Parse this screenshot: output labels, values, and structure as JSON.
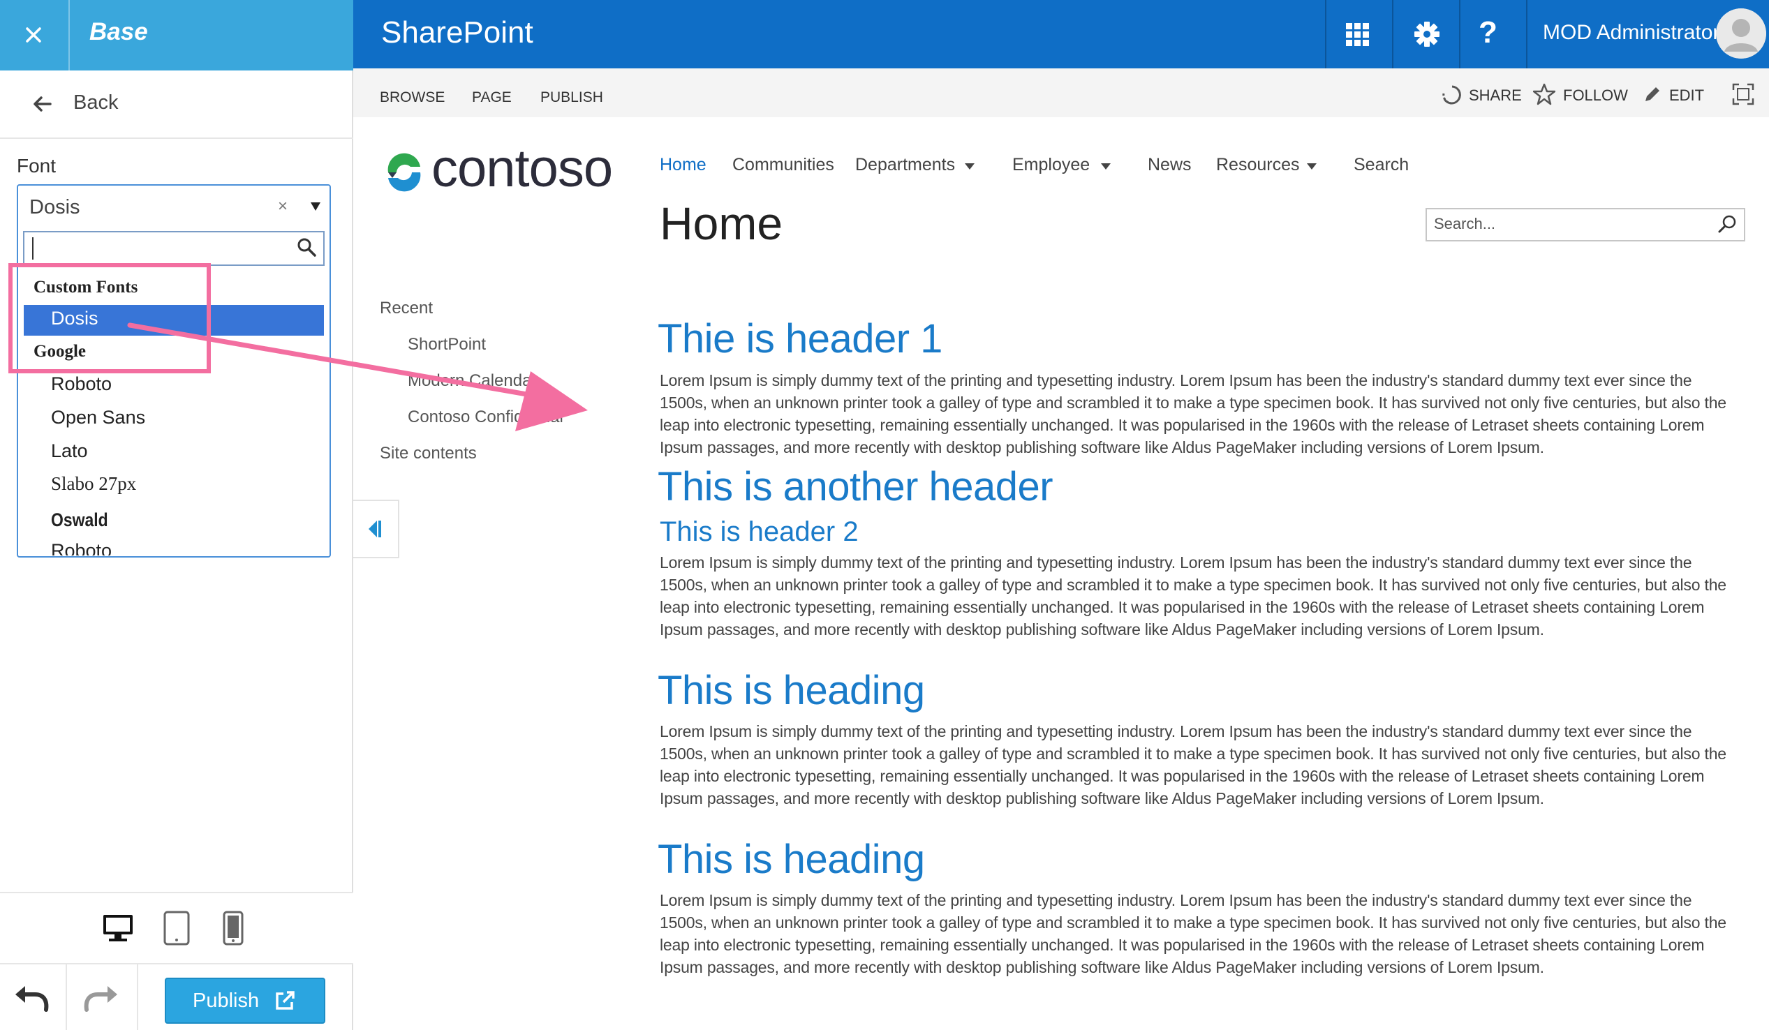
{
  "panel": {
    "title": "Base",
    "back_label": "Back",
    "font_label": "Font",
    "select": {
      "value": "Dosis",
      "clear": "×",
      "search_value": "",
      "groups": [
        {
          "label": "Custom Fonts",
          "options": [
            "Dosis"
          ]
        },
        {
          "label": "Google",
          "options": [
            "Roboto",
            "Open Sans",
            "Lato",
            "Slabo 27px",
            "Oswald",
            "Roboto Condensed"
          ]
        }
      ],
      "selected": "Dosis"
    },
    "publish_label": "Publish",
    "icons": [
      "close-icon",
      "back-arrow-icon",
      "search-icon",
      "desktop-icon",
      "tablet-icon",
      "mobile-icon",
      "undo-icon",
      "redo-icon",
      "external-link-icon"
    ]
  },
  "suitebar": {
    "brand": "SharePoint",
    "help": "?",
    "user_name": "MOD Administrator",
    "icons": [
      "app-launcher-icon",
      "gear-icon",
      "help-icon",
      "avatar"
    ]
  },
  "ribbon": {
    "tabs": [
      "BROWSE",
      "PAGE",
      "PUBLISH"
    ],
    "actions": [
      {
        "label": "SHARE",
        "icon": "share-icon"
      },
      {
        "label": "FOLLOW",
        "icon": "star-icon"
      },
      {
        "label": "EDIT",
        "icon": "pencil-icon"
      }
    ]
  },
  "site": {
    "logo_text": "contoso",
    "nav": [
      "Home",
      "Communities",
      "Departments",
      "Employee",
      "News",
      "Resources",
      "Search"
    ],
    "page_title": "Home",
    "search_placeholder": "Search..."
  },
  "quick_launch": {
    "recent": "Recent",
    "items": [
      "ShortPoint",
      "Modern Calendar",
      "Contoso Confidential"
    ],
    "site_contents": "Site contents"
  },
  "content": {
    "header1": "Thie is header 1",
    "another_header": "This is another header",
    "header2": "This is header 2",
    "heading": "This is heading",
    "lorem": "Lorem Ipsum is simply dummy text of the printing and typesetting industry. Lorem Ipsum has been the industry's standard dummy text ever since the 1500s, when an unknown printer took a galley of type and scrambled it to make a type specimen book. It has survived not only five centuries, but also the leap into electronic typesetting, remaining essentially unchanged. It was popularised in the 1960s with the release of Letraset sheets containing Lorem Ipsum passages, and more recently with desktop publishing software like Aldus PageMaker including versions of Lorem Ipsum."
  },
  "colors": {
    "panel_header": "#3aa7dc",
    "suitebar": "#0f6ec6",
    "selected_option": "#3875d7",
    "heading": "#1a7bc9",
    "annotation": "#f36ea0"
  }
}
